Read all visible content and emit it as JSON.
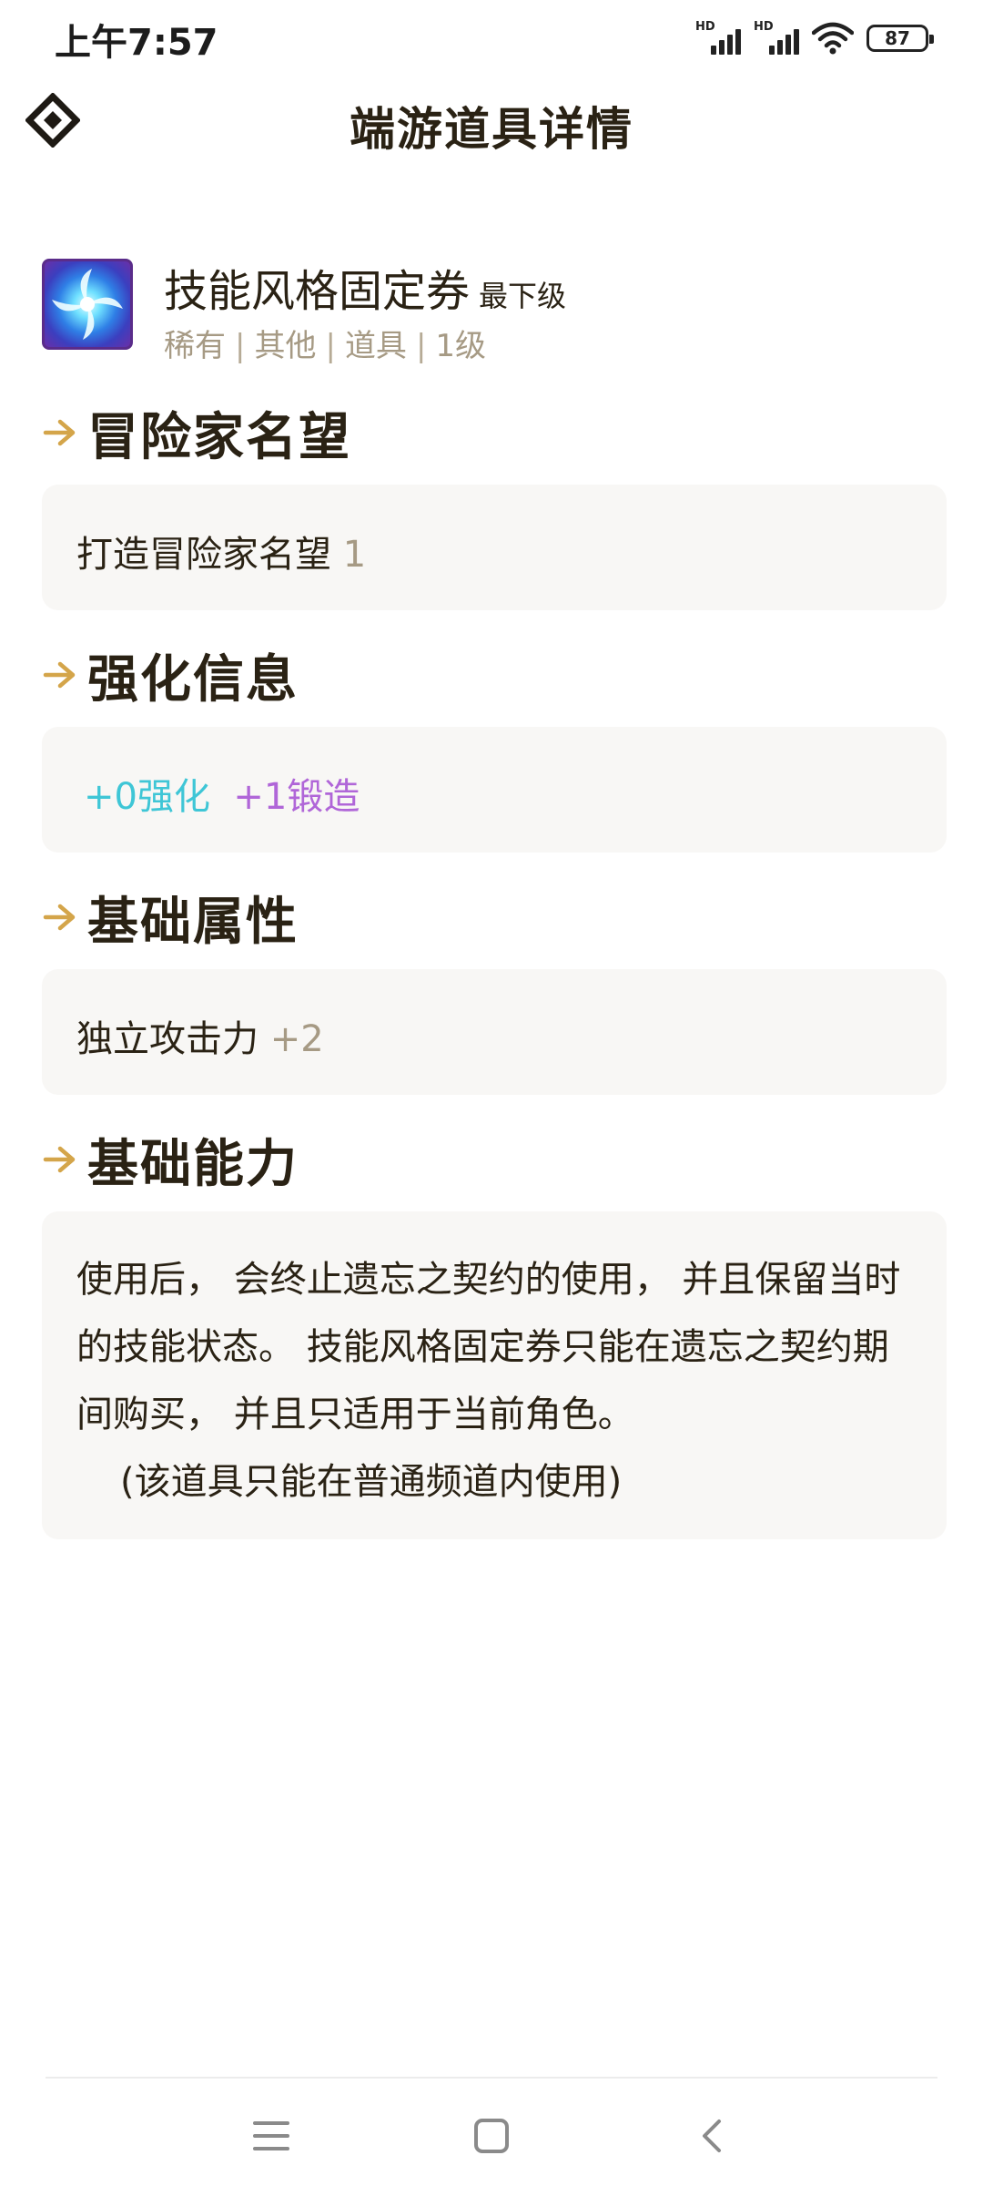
{
  "status": {
    "time": "上午7:57",
    "signal_labels": [
      "HD",
      "HD"
    ],
    "battery": "87",
    "icons": [
      "signal-icon",
      "signal-icon",
      "wifi-icon",
      "battery-icon"
    ]
  },
  "header": {
    "title": "端游道具详情",
    "logo_icon": "diamond-logo-icon"
  },
  "item": {
    "name": "技能风格固定券",
    "tier": "最下级",
    "meta": [
      "稀有",
      "其他",
      "道具",
      "1级"
    ],
    "meta_separator": "|",
    "icon": "swirl-item-icon"
  },
  "sections": {
    "reputation": {
      "title": "冒险家名望",
      "label": "打造冒险家名望",
      "value": "1"
    },
    "enhance": {
      "title": "强化信息",
      "reinforce": "+0强化",
      "forge": "+1锻造"
    },
    "base_attr": {
      "title": "基础属性",
      "label": "独立攻击力",
      "value": "+2"
    },
    "base_ability": {
      "title": "基础能力",
      "text": "使用后， 会终止遗忘之契约的使用， 并且保留当时的技能状态。 技能风格固定券只能在遗忘之契约期间购买， 并且只适用于当前角色。",
      "note": "(该道具只能在普通频道内使用)"
    }
  },
  "colors": {
    "title": "#2a2214",
    "muted": "#a69a84",
    "card_bg": "#f8f7f5",
    "reinforce": "#3fc6d6",
    "forge": "#b066d8",
    "accent_arrow": "#d4a54a"
  },
  "nav": {
    "icons": [
      "menu-icon",
      "home-icon",
      "back-icon"
    ]
  }
}
